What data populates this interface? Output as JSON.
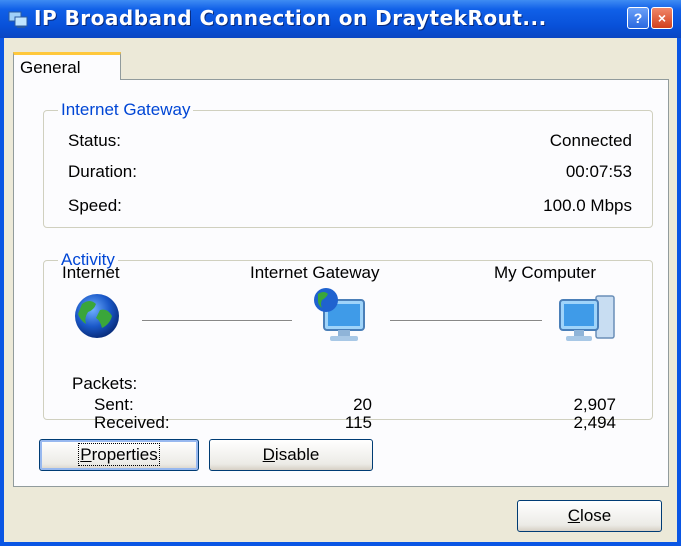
{
  "window": {
    "title": "IP Broadband Connection on DraytekRout...",
    "help_label": "?",
    "close_label": "×"
  },
  "tabs": [
    {
      "label": "General"
    }
  ],
  "gateway": {
    "legend": "Internet Gateway",
    "rows": [
      {
        "label": "Status:",
        "value": "Connected"
      },
      {
        "label": "Duration:",
        "value": "00:07:53"
      },
      {
        "label": "Speed:",
        "value": "100.0 Mbps"
      }
    ]
  },
  "activity": {
    "legend": "Activity",
    "nodes": [
      {
        "label": "Internet",
        "icon": "globe-icon"
      },
      {
        "label": "Internet Gateway",
        "icon": "gateway-computer-icon"
      },
      {
        "label": "My Computer",
        "icon": "computer-icon"
      }
    ],
    "packets_label": "Packets:",
    "sent_label": "Sent:",
    "received_label": "Received:",
    "gateway_sent": "20",
    "gateway_received": "115",
    "computer_sent": "2,907",
    "computer_received": "2,494"
  },
  "buttons": {
    "properties": {
      "mnemonic": "P",
      "rest": "roperties"
    },
    "disable": {
      "mnemonic": "D",
      "rest": "isable"
    },
    "close": {
      "mnemonic": "C",
      "rest": "lose"
    }
  },
  "colors": {
    "titlebar": "#0a56e4",
    "legend": "#0046d5",
    "dialog_bg": "#ece9d8"
  }
}
